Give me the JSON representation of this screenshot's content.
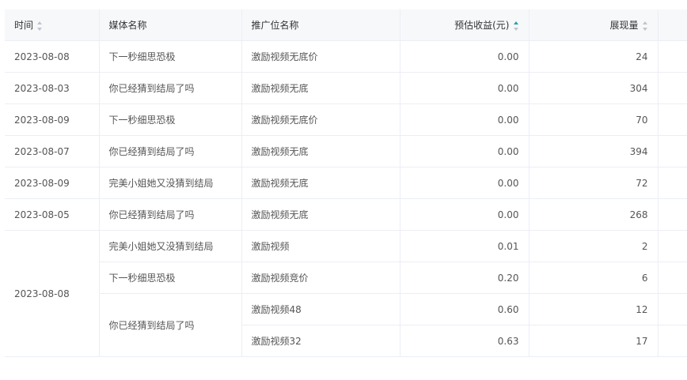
{
  "headers": {
    "date": "时间",
    "media": "媒体名称",
    "slot": "推广位名称",
    "revenue": "预估收益(元)",
    "impressions": "展现量"
  },
  "sort": {
    "date": "sort-none",
    "revenue": "ascending",
    "impressions": "sort-none"
  },
  "rows": [
    {
      "date": "2023-08-08",
      "media": "下一秒细思恐极",
      "slot": "激励视频无底价",
      "revenue": "0.00",
      "impressions": "24"
    },
    {
      "date": "2023-08-03",
      "media": "你已经猜到结局了吗",
      "slot": "激励视频无底",
      "revenue": "0.00",
      "impressions": "304"
    },
    {
      "date": "2023-08-09",
      "media": "下一秒细思恐极",
      "slot": "激励视频无底价",
      "revenue": "0.00",
      "impressions": "70"
    },
    {
      "date": "2023-08-07",
      "media": "你已经猜到结局了吗",
      "slot": "激励视频无底",
      "revenue": "0.00",
      "impressions": "394"
    },
    {
      "date": "2023-08-09",
      "media": "完美小姐她又没猜到结局",
      "slot": "激励视频无底",
      "revenue": "0.00",
      "impressions": "72"
    },
    {
      "date": "2023-08-05",
      "media": "你已经猜到结局了吗",
      "slot": "激励视频无底",
      "revenue": "0.00",
      "impressions": "268"
    }
  ],
  "group": {
    "date": "2023-08-08",
    "entries": [
      {
        "media": "完美小姐她又没猜到结局",
        "slot": "激励视频",
        "revenue": "0.01",
        "impressions": "2"
      },
      {
        "media": "下一秒细思恐极",
        "slot": "激励视频竞价",
        "revenue": "0.20",
        "impressions": "6"
      },
      {
        "media": "你已经猜到结局了吗",
        "slot": "激励视频48",
        "revenue": "0.60",
        "impressions": "12"
      },
      {
        "slot": "激励视频32",
        "revenue": "0.63",
        "impressions": "17"
      }
    ]
  }
}
